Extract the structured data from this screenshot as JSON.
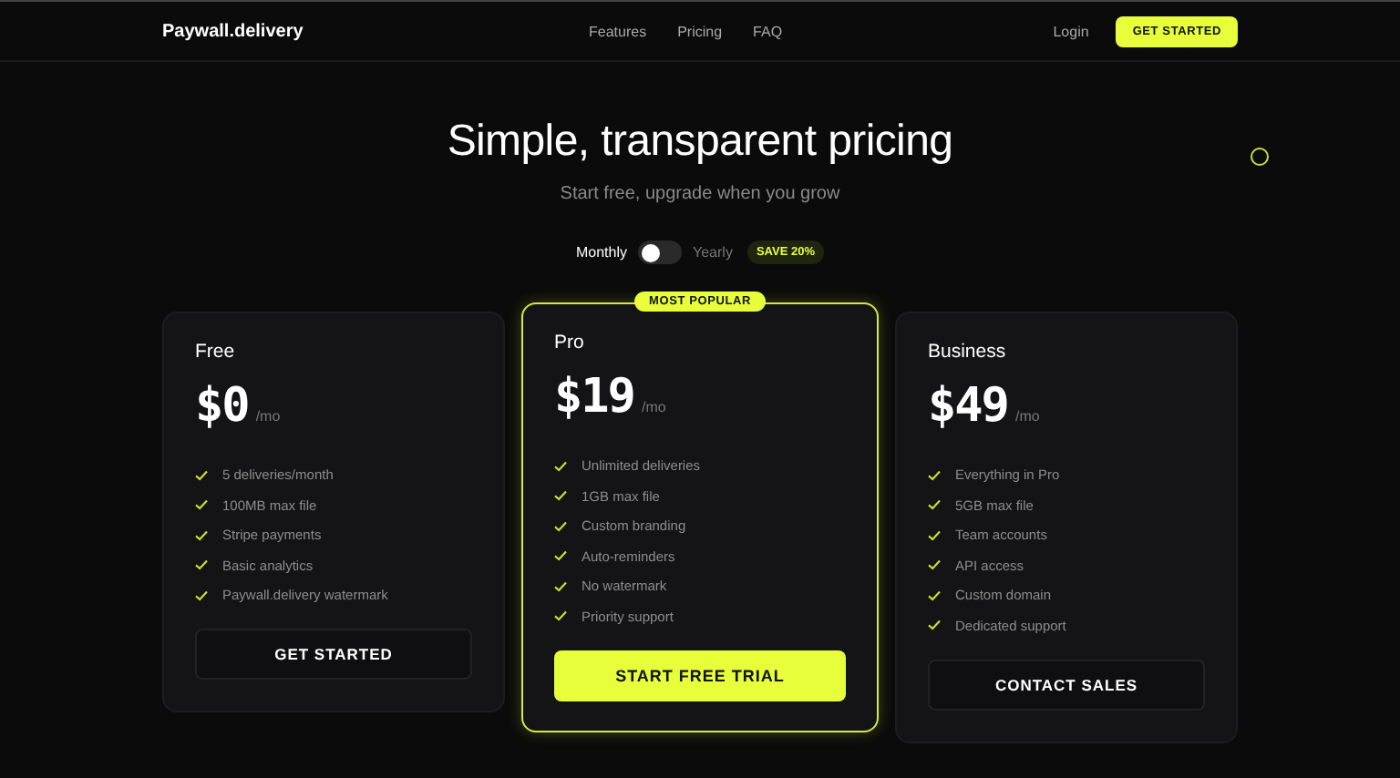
{
  "nav": {
    "brand": "Paywall.delivery",
    "links": [
      "Features",
      "Pricing",
      "FAQ"
    ],
    "login": "Login",
    "cta": "GET STARTED"
  },
  "hero": {
    "title": "Simple, transparent pricing",
    "subtitle": "Start free, upgrade when you grow"
  },
  "billing": {
    "monthly": "Monthly",
    "yearly_label": "Yearly",
    "yearly": false,
    "badge": "SAVE 20%"
  },
  "plans": [
    {
      "name": "Free",
      "price": "$0",
      "period": "/mo",
      "featured": false,
      "features": [
        "5 deliveries/month",
        "100MB max file",
        "Stripe payments",
        "Basic analytics",
        "Paywall.delivery watermark"
      ],
      "button": "GET STARTED"
    },
    {
      "name": "Pro",
      "price": "$19",
      "period": "/mo",
      "featured": true,
      "badge": "MOST POPULAR",
      "features": [
        "Unlimited deliveries",
        "1GB max file",
        "Custom branding",
        "Auto-reminders",
        "No watermark",
        "Priority support"
      ],
      "button": "START FREE TRIAL"
    },
    {
      "name": "Business",
      "price": "$49",
      "period": "/mo",
      "featured": false,
      "features": [
        "Everything in Pro",
        "5GB max file",
        "Team accounts",
        "API access",
        "Custom domain",
        "Dedicated support"
      ],
      "button": "CONTACT SALES"
    }
  ]
}
